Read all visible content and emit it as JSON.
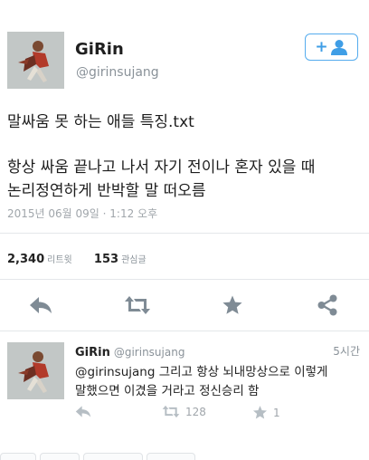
{
  "tweet": {
    "display_name": "GiRin",
    "handle": "@girinsujang",
    "text_line1": "말싸움 못 하는 애들 특징.txt",
    "text_line2": "항상 싸움 끝나고 나서 자기 전이나 혼자 있을 때",
    "text_line3": "논리정연하게 반박할 말 떠오름",
    "timestamp": "2015년 06월 09일 · 1:12 오후",
    "retweets_count": "2,340",
    "retweets_label": "리트윗",
    "favorites_count": "153",
    "favorites_label": "관심글"
  },
  "reply": {
    "display_name": "GiRin",
    "handle": "@girinsujang",
    "time": "5시간",
    "text_line1": "@girinsujang 그리고 항상 뇌내망상으로 이렇게",
    "text_line2": "말했으면 이겼을 거라고 정신승리 함",
    "retweet_count": "128",
    "favorite_count": "1"
  },
  "colors": {
    "accent": "#55acee",
    "icon": "#7f8b95",
    "muted_icon": "#b6bec4"
  }
}
